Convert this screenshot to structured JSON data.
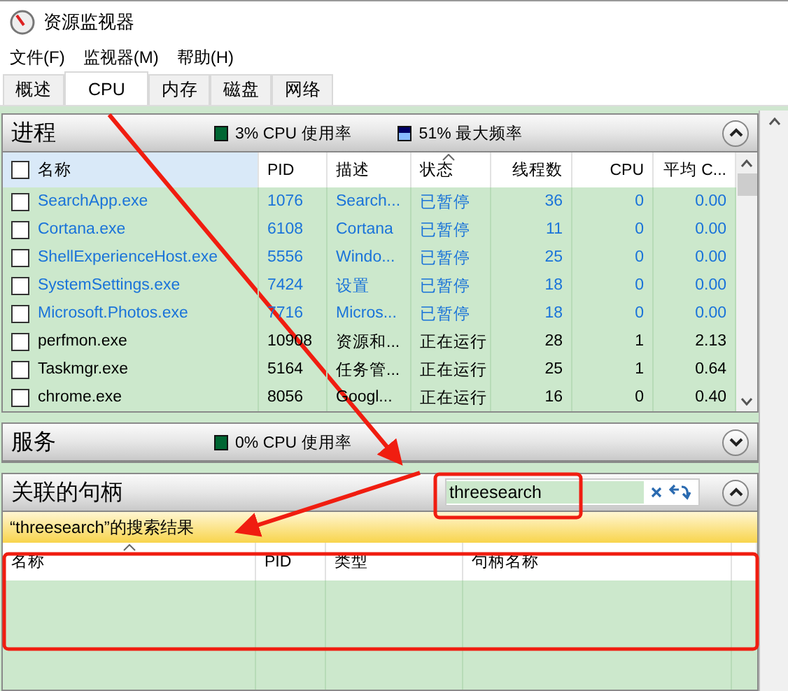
{
  "window": {
    "title": "资源监视器"
  },
  "menu": [
    "文件(F)",
    "监视器(M)",
    "帮助(H)"
  ],
  "tabs": [
    {
      "label": "概述",
      "selected": false
    },
    {
      "label": "CPU",
      "selected": true
    },
    {
      "label": "内存",
      "selected": false
    },
    {
      "label": "磁盘",
      "selected": false
    },
    {
      "label": "网络",
      "selected": false
    }
  ],
  "processes": {
    "title": "进程",
    "cpu_usage": "3% CPU 使用率",
    "max_frequency": "51% 最大频率",
    "expanded": true,
    "all_checked": false,
    "columns": [
      "名称",
      "PID",
      "描述",
      "状态",
      "线程数",
      "CPU",
      "平均 C..."
    ],
    "rows": [
      {
        "checked": false,
        "suspended": true,
        "cells": [
          "SearchApp.exe",
          "1076",
          "Search...",
          "已暂停",
          "36",
          "0",
          "0.00"
        ]
      },
      {
        "checked": false,
        "suspended": true,
        "cells": [
          "Cortana.exe",
          "6108",
          "Cortana",
          "已暂停",
          "11",
          "0",
          "0.00"
        ]
      },
      {
        "checked": false,
        "suspended": true,
        "cells": [
          "ShellExperienceHost.exe",
          "5556",
          "Windo...",
          "已暂停",
          "25",
          "0",
          "0.00"
        ]
      },
      {
        "checked": false,
        "suspended": true,
        "cells": [
          "SystemSettings.exe",
          "7424",
          "设置",
          "已暂停",
          "18",
          "0",
          "0.00"
        ]
      },
      {
        "checked": false,
        "suspended": true,
        "cells": [
          "Microsoft.Photos.exe",
          "7716",
          "Micros...",
          "已暂停",
          "18",
          "0",
          "0.00"
        ]
      },
      {
        "checked": false,
        "suspended": false,
        "cells": [
          "perfmon.exe",
          "10908",
          "资源和...",
          "正在运行",
          "28",
          "1",
          "2.13"
        ]
      },
      {
        "checked": false,
        "suspended": false,
        "cells": [
          "Taskmgr.exe",
          "5164",
          "任务管...",
          "正在运行",
          "25",
          "1",
          "0.64"
        ]
      },
      {
        "checked": false,
        "suspended": false,
        "cells": [
          "chrome.exe",
          "8056",
          "Googl...",
          "正在运行",
          "16",
          "0",
          "0.40"
        ]
      }
    ]
  },
  "services": {
    "title": "服务",
    "cpu_usage": "0% CPU 使用率",
    "expanded": false
  },
  "handles": {
    "title": "关联的句柄",
    "expanded": true,
    "search": {
      "value": "threesearch"
    },
    "result": "“threesearch”的搜索结果",
    "columns": [
      "名称",
      "PID",
      "类型",
      "句柄名称"
    ]
  }
}
